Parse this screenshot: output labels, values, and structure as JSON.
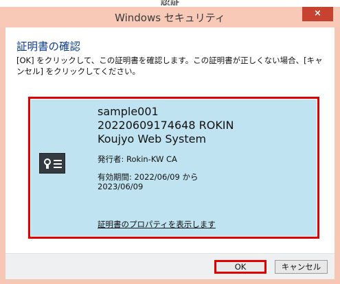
{
  "top_partial_text": "認証",
  "window": {
    "title": "Windows セキュリティ",
    "close_glyph": "×"
  },
  "dialog": {
    "heading": "証明書の確認",
    "description": "[OK] をクリックして、この証明書を確認します。この証明書が正しくない場合、[キャンセル] をクリックしてください。"
  },
  "certificate": {
    "icon": "certificate-icon",
    "name_line1": "sample001",
    "name_line2": "20220609174648 ROKIN",
    "name_line3": "Koujyo Web System",
    "issuer": "発行者: Rokin-KW CA",
    "validity_line1": "有効期間: 2022/06/09 から",
    "validity_line2": "2023/06/09",
    "properties_link": "証明書のプロパティを表示します"
  },
  "buttons": {
    "ok": "OK",
    "cancel": "キャンセル"
  },
  "colors": {
    "titlebar": "#f8c9b7",
    "close": "#c7432f",
    "heading": "#0b3d8f",
    "cert_panel": "#bfe3f0",
    "highlight": "#e00000"
  }
}
